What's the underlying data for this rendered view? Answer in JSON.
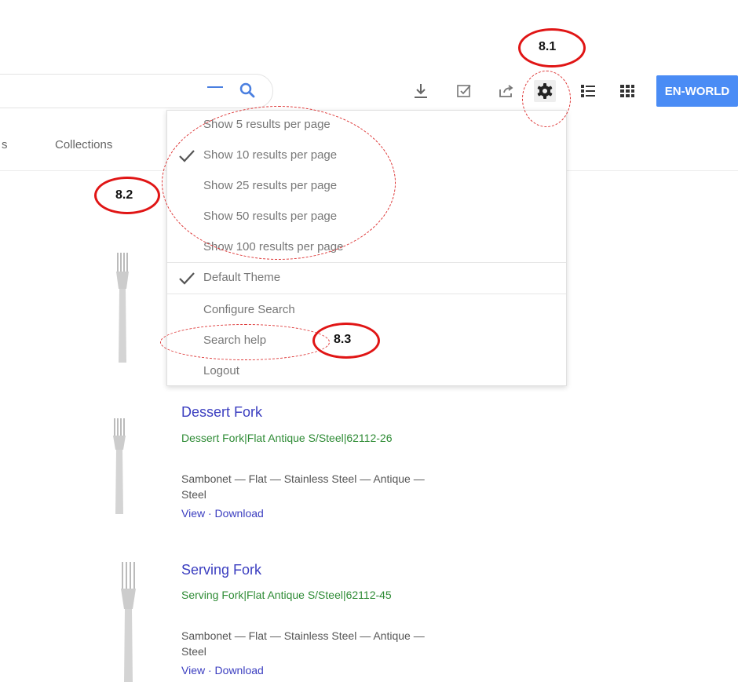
{
  "toolbar": {
    "download_icon": "download-icon",
    "select_icon": "checkbox-icon",
    "share_icon": "share-icon",
    "settings_icon": "gear-icon",
    "list_view_icon": "list-view-icon",
    "grid_view_icon": "grid-view-icon",
    "locale_label": "EN-WORLD"
  },
  "search": {
    "value": ""
  },
  "tabs": {
    "prev_partial": "s",
    "collections": "Collections"
  },
  "menu": {
    "results_per_page": [
      {
        "label": "Show 5 results per page",
        "checked": false
      },
      {
        "label": "Show 10 results per page",
        "checked": true
      },
      {
        "label": "Show 25 results per page",
        "checked": false
      },
      {
        "label": "Show 50 results per page",
        "checked": false
      },
      {
        "label": "Show 100 results per page",
        "checked": false
      }
    ],
    "theme": {
      "label": "Default Theme",
      "checked": true
    },
    "configure": "Configure Search",
    "help": "Search help",
    "logout": "Logout"
  },
  "results": [
    {
      "title": "Dessert Fork",
      "subtitle": "Dessert Fork|Flat Antique S/Steel|62112-26",
      "meta": "Sambonet — Flat — Stainless Steel — Antique — Steel",
      "view": "View",
      "sep": "·",
      "download": "Download"
    },
    {
      "title": "Serving Fork",
      "subtitle": "Serving Fork|Flat Antique S/Steel|62112-45",
      "meta": "Sambonet — Flat — Stainless Steel — Antique — Steel",
      "view": "View",
      "sep": "·",
      "download": "Download"
    }
  ],
  "annotations": {
    "a1": "8.1",
    "a2": "8.2",
    "a3": "8.3"
  },
  "colors": {
    "accent": "#4a8cf5",
    "link": "#3b3ec0",
    "sub": "#2e8b35",
    "annotation": "#e01515"
  }
}
